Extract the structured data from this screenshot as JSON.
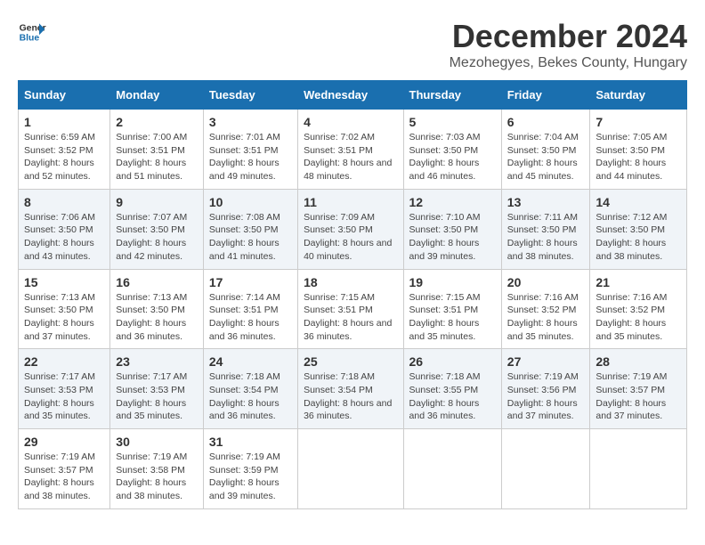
{
  "logo": {
    "line1": "General",
    "line2": "Blue"
  },
  "title": "December 2024",
  "subtitle": "Mezohegyes, Bekes County, Hungary",
  "days_header": [
    "Sunday",
    "Monday",
    "Tuesday",
    "Wednesday",
    "Thursday",
    "Friday",
    "Saturday"
  ],
  "weeks": [
    [
      {
        "day": "1",
        "sunrise": "Sunrise: 6:59 AM",
        "sunset": "Sunset: 3:52 PM",
        "daylight": "Daylight: 8 hours and 52 minutes."
      },
      {
        "day": "2",
        "sunrise": "Sunrise: 7:00 AM",
        "sunset": "Sunset: 3:51 PM",
        "daylight": "Daylight: 8 hours and 51 minutes."
      },
      {
        "day": "3",
        "sunrise": "Sunrise: 7:01 AM",
        "sunset": "Sunset: 3:51 PM",
        "daylight": "Daylight: 8 hours and 49 minutes."
      },
      {
        "day": "4",
        "sunrise": "Sunrise: 7:02 AM",
        "sunset": "Sunset: 3:51 PM",
        "daylight": "Daylight: 8 hours and 48 minutes."
      },
      {
        "day": "5",
        "sunrise": "Sunrise: 7:03 AM",
        "sunset": "Sunset: 3:50 PM",
        "daylight": "Daylight: 8 hours and 46 minutes."
      },
      {
        "day": "6",
        "sunrise": "Sunrise: 7:04 AM",
        "sunset": "Sunset: 3:50 PM",
        "daylight": "Daylight: 8 hours and 45 minutes."
      },
      {
        "day": "7",
        "sunrise": "Sunrise: 7:05 AM",
        "sunset": "Sunset: 3:50 PM",
        "daylight": "Daylight: 8 hours and 44 minutes."
      }
    ],
    [
      {
        "day": "8",
        "sunrise": "Sunrise: 7:06 AM",
        "sunset": "Sunset: 3:50 PM",
        "daylight": "Daylight: 8 hours and 43 minutes."
      },
      {
        "day": "9",
        "sunrise": "Sunrise: 7:07 AM",
        "sunset": "Sunset: 3:50 PM",
        "daylight": "Daylight: 8 hours and 42 minutes."
      },
      {
        "day": "10",
        "sunrise": "Sunrise: 7:08 AM",
        "sunset": "Sunset: 3:50 PM",
        "daylight": "Daylight: 8 hours and 41 minutes."
      },
      {
        "day": "11",
        "sunrise": "Sunrise: 7:09 AM",
        "sunset": "Sunset: 3:50 PM",
        "daylight": "Daylight: 8 hours and 40 minutes."
      },
      {
        "day": "12",
        "sunrise": "Sunrise: 7:10 AM",
        "sunset": "Sunset: 3:50 PM",
        "daylight": "Daylight: 8 hours and 39 minutes."
      },
      {
        "day": "13",
        "sunrise": "Sunrise: 7:11 AM",
        "sunset": "Sunset: 3:50 PM",
        "daylight": "Daylight: 8 hours and 38 minutes."
      },
      {
        "day": "14",
        "sunrise": "Sunrise: 7:12 AM",
        "sunset": "Sunset: 3:50 PM",
        "daylight": "Daylight: 8 hours and 38 minutes."
      }
    ],
    [
      {
        "day": "15",
        "sunrise": "Sunrise: 7:13 AM",
        "sunset": "Sunset: 3:50 PM",
        "daylight": "Daylight: 8 hours and 37 minutes."
      },
      {
        "day": "16",
        "sunrise": "Sunrise: 7:13 AM",
        "sunset": "Sunset: 3:50 PM",
        "daylight": "Daylight: 8 hours and 36 minutes."
      },
      {
        "day": "17",
        "sunrise": "Sunrise: 7:14 AM",
        "sunset": "Sunset: 3:51 PM",
        "daylight": "Daylight: 8 hours and 36 minutes."
      },
      {
        "day": "18",
        "sunrise": "Sunrise: 7:15 AM",
        "sunset": "Sunset: 3:51 PM",
        "daylight": "Daylight: 8 hours and 36 minutes."
      },
      {
        "day": "19",
        "sunrise": "Sunrise: 7:15 AM",
        "sunset": "Sunset: 3:51 PM",
        "daylight": "Daylight: 8 hours and 35 minutes."
      },
      {
        "day": "20",
        "sunrise": "Sunrise: 7:16 AM",
        "sunset": "Sunset: 3:52 PM",
        "daylight": "Daylight: 8 hours and 35 minutes."
      },
      {
        "day": "21",
        "sunrise": "Sunrise: 7:16 AM",
        "sunset": "Sunset: 3:52 PM",
        "daylight": "Daylight: 8 hours and 35 minutes."
      }
    ],
    [
      {
        "day": "22",
        "sunrise": "Sunrise: 7:17 AM",
        "sunset": "Sunset: 3:53 PM",
        "daylight": "Daylight: 8 hours and 35 minutes."
      },
      {
        "day": "23",
        "sunrise": "Sunrise: 7:17 AM",
        "sunset": "Sunset: 3:53 PM",
        "daylight": "Daylight: 8 hours and 35 minutes."
      },
      {
        "day": "24",
        "sunrise": "Sunrise: 7:18 AM",
        "sunset": "Sunset: 3:54 PM",
        "daylight": "Daylight: 8 hours and 36 minutes."
      },
      {
        "day": "25",
        "sunrise": "Sunrise: 7:18 AM",
        "sunset": "Sunset: 3:54 PM",
        "daylight": "Daylight: 8 hours and 36 minutes."
      },
      {
        "day": "26",
        "sunrise": "Sunrise: 7:18 AM",
        "sunset": "Sunset: 3:55 PM",
        "daylight": "Daylight: 8 hours and 36 minutes."
      },
      {
        "day": "27",
        "sunrise": "Sunrise: 7:19 AM",
        "sunset": "Sunset: 3:56 PM",
        "daylight": "Daylight: 8 hours and 37 minutes."
      },
      {
        "day": "28",
        "sunrise": "Sunrise: 7:19 AM",
        "sunset": "Sunset: 3:57 PM",
        "daylight": "Daylight: 8 hours and 37 minutes."
      }
    ],
    [
      {
        "day": "29",
        "sunrise": "Sunrise: 7:19 AM",
        "sunset": "Sunset: 3:57 PM",
        "daylight": "Daylight: 8 hours and 38 minutes."
      },
      {
        "day": "30",
        "sunrise": "Sunrise: 7:19 AM",
        "sunset": "Sunset: 3:58 PM",
        "daylight": "Daylight: 8 hours and 38 minutes."
      },
      {
        "day": "31",
        "sunrise": "Sunrise: 7:19 AM",
        "sunset": "Sunset: 3:59 PM",
        "daylight": "Daylight: 8 hours and 39 minutes."
      },
      null,
      null,
      null,
      null
    ]
  ]
}
